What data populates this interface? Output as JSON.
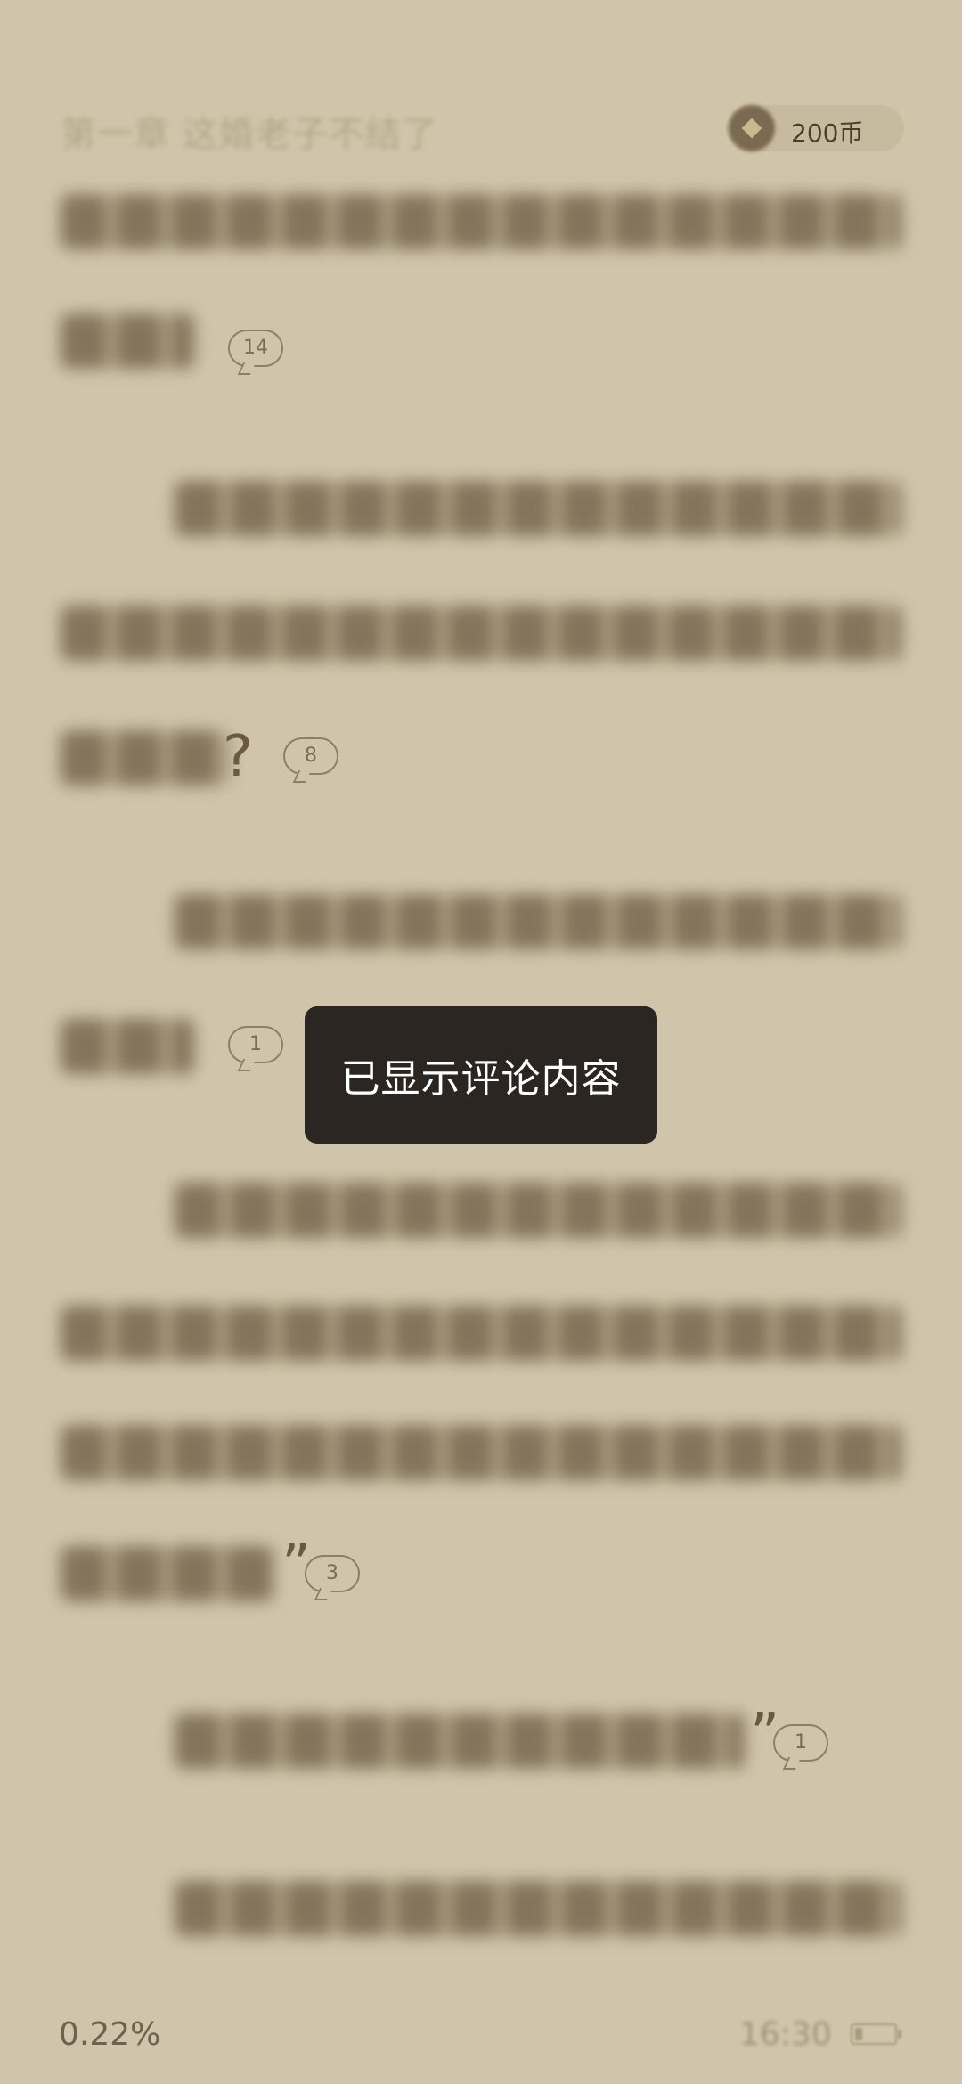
{
  "header": {
    "chapter_title": "第一章 这婚老子不结了",
    "coin_balance": "200币"
  },
  "comment_counts": [
    "14",
    "8",
    "1",
    "3",
    "1"
  ],
  "punctuation": {
    "question_mark": "?",
    "close_quote_1": "”",
    "close_quote_2": "”"
  },
  "toast": {
    "message": "已显示评论内容"
  },
  "footer": {
    "progress": "0.22%",
    "time": "16:30",
    "battery_level": 0.2
  }
}
